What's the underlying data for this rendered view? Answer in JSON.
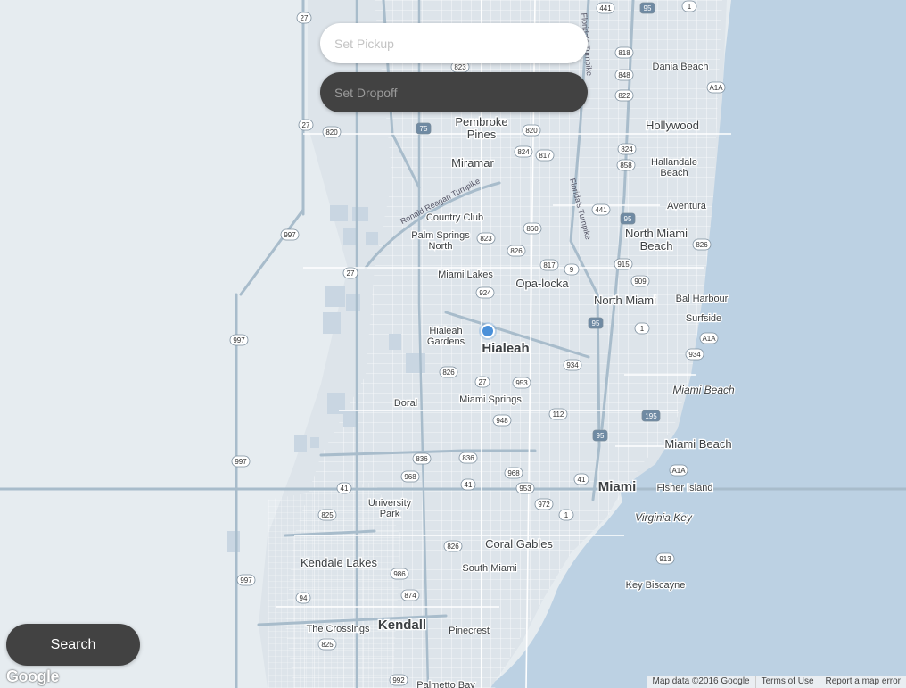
{
  "pickup": {
    "placeholder": "Set Pickup",
    "value": ""
  },
  "dropoff": {
    "placeholder": "Set Dropoff",
    "value": ""
  },
  "search_button": {
    "label": "Search"
  },
  "map": {
    "logo": "Google",
    "attribution": {
      "map_data": "Map data ©2016 Google",
      "terms": "Terms of Use",
      "report": "Report a map error"
    },
    "colors": {
      "land": "#e6ecf0",
      "water": "#bcd1e3",
      "urban": "#dde4ea",
      "road": "#ffffff",
      "highway": "#a8bccb",
      "label": "#3c4043"
    },
    "places": [
      {
        "name": "Dania Beach",
        "size": "small"
      },
      {
        "name": "Hollywood",
        "size": "medium"
      },
      {
        "name": "Pembroke\nPines",
        "size": "medium"
      },
      {
        "name": "Miramar",
        "size": "medium"
      },
      {
        "name": "Hallandale\nBeach",
        "size": "small"
      },
      {
        "name": "Aventura",
        "size": "small"
      },
      {
        "name": "Country Club",
        "size": "small"
      },
      {
        "name": "Palm Springs\nNorth",
        "size": "small"
      },
      {
        "name": "North Miami\nBeach",
        "size": "medium"
      },
      {
        "name": "Miami Lakes",
        "size": "small"
      },
      {
        "name": "Opa-locka",
        "size": "medium"
      },
      {
        "name": "Bal Harbour",
        "size": "small"
      },
      {
        "name": "North Miami",
        "size": "medium"
      },
      {
        "name": "Surfside",
        "size": "small"
      },
      {
        "name": "Hialeah\nGardens",
        "size": "small"
      },
      {
        "name": "Hialeah",
        "size": "large"
      },
      {
        "name": "Miami Beach",
        "size": "italic"
      },
      {
        "name": "Doral",
        "size": "small"
      },
      {
        "name": "Miami Springs",
        "size": "small"
      },
      {
        "name": "Miami Beach",
        "size": "medium"
      },
      {
        "name": "Miami",
        "size": "large"
      },
      {
        "name": "Fisher Island",
        "size": "small"
      },
      {
        "name": "University\nPark",
        "size": "small"
      },
      {
        "name": "Virginia Key",
        "size": "italic"
      },
      {
        "name": "Coral Gables",
        "size": "medium"
      },
      {
        "name": "Kendale Lakes",
        "size": "medium"
      },
      {
        "name": "South Miami",
        "size": "small"
      },
      {
        "name": "Key Biscayne",
        "size": "small"
      },
      {
        "name": "Kendall",
        "size": "large"
      },
      {
        "name": "The Crossings",
        "size": "small"
      },
      {
        "name": "Pinecrest",
        "size": "small"
      },
      {
        "name": "Palmetto Bay",
        "size": "small"
      }
    ],
    "route_shields": [
      {
        "ref": "441"
      },
      {
        "ref": "95",
        "type": "interstate"
      },
      {
        "ref": "1",
        "type": "us"
      },
      {
        "ref": "27",
        "type": "us"
      },
      {
        "ref": "818"
      },
      {
        "ref": "848"
      },
      {
        "ref": "822"
      },
      {
        "ref": "A1A"
      },
      {
        "ref": "823"
      },
      {
        "ref": "75",
        "type": "interstate"
      },
      {
        "ref": "820"
      },
      {
        "ref": "27",
        "type": "us"
      },
      {
        "ref": "820"
      },
      {
        "ref": "824"
      },
      {
        "ref": "817"
      },
      {
        "ref": "824"
      },
      {
        "ref": "858"
      },
      {
        "ref": "441",
        "type": "us"
      },
      {
        "ref": "95",
        "type": "interstate"
      },
      {
        "ref": "860"
      },
      {
        "ref": "823"
      },
      {
        "ref": "997"
      },
      {
        "ref": "826"
      },
      {
        "ref": "27",
        "type": "us"
      },
      {
        "ref": "817"
      },
      {
        "ref": "9"
      },
      {
        "ref": "915"
      },
      {
        "ref": "826"
      },
      {
        "ref": "909"
      },
      {
        "ref": "924"
      },
      {
        "ref": "95",
        "type": "interstate"
      },
      {
        "ref": "1",
        "type": "us"
      },
      {
        "ref": "997"
      },
      {
        "ref": "A1A"
      },
      {
        "ref": "934"
      },
      {
        "ref": "934"
      },
      {
        "ref": "826"
      },
      {
        "ref": "27",
        "type": "us"
      },
      {
        "ref": "953"
      },
      {
        "ref": "112"
      },
      {
        "ref": "195",
        "type": "interstate"
      },
      {
        "ref": "948"
      },
      {
        "ref": "95",
        "type": "interstate"
      },
      {
        "ref": "836"
      },
      {
        "ref": "836"
      },
      {
        "ref": "997"
      },
      {
        "ref": "968"
      },
      {
        "ref": "968"
      },
      {
        "ref": "41",
        "type": "us"
      },
      {
        "ref": "41",
        "type": "us"
      },
      {
        "ref": "41",
        "type": "us"
      },
      {
        "ref": "953"
      },
      {
        "ref": "A1A"
      },
      {
        "ref": "825"
      },
      {
        "ref": "972"
      },
      {
        "ref": "1",
        "type": "us"
      },
      {
        "ref": "826"
      },
      {
        "ref": "913"
      },
      {
        "ref": "997"
      },
      {
        "ref": "986"
      },
      {
        "ref": "94"
      },
      {
        "ref": "874"
      },
      {
        "ref": "825"
      },
      {
        "ref": "992"
      }
    ],
    "road_labels": [
      {
        "name": "Ronald Reagan Turnpike"
      },
      {
        "name": "Florida's Turnpike"
      },
      {
        "name": "Florida's Turnpike"
      }
    ],
    "location_marker": {
      "name": "current-location"
    }
  }
}
